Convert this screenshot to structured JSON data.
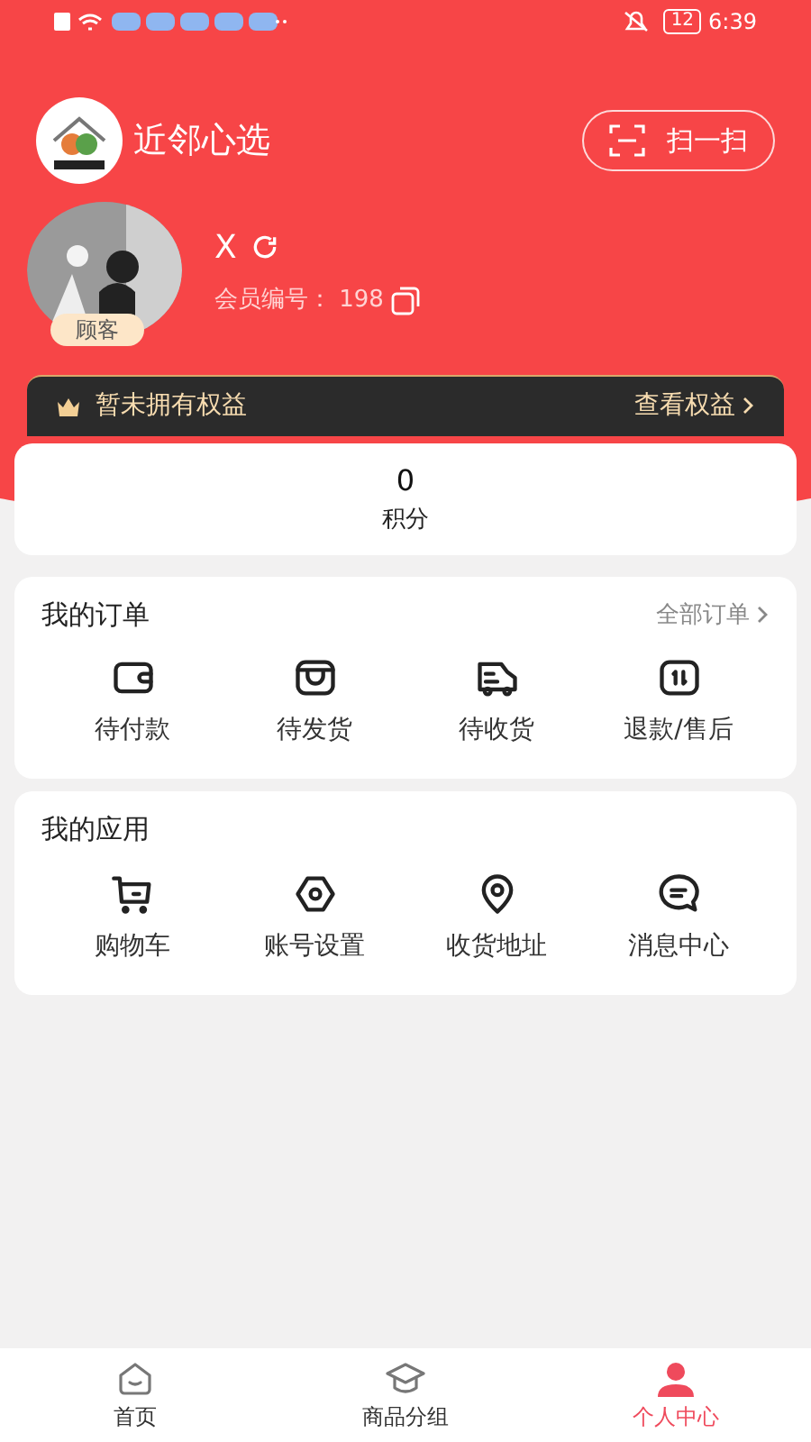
{
  "status_bar": {
    "battery": "12",
    "time": "6:39"
  },
  "header": {
    "app_name": "近邻心选",
    "scan_button": "扫一扫"
  },
  "profile": {
    "name": "X",
    "member_label": "会员编号：",
    "member_no": "198",
    "badge": "顾客"
  },
  "benefits": {
    "text": "暂未拥有权益",
    "link": "查看权益"
  },
  "points": {
    "value": "0",
    "label": "积分"
  },
  "orders": {
    "title": "我的订单",
    "link": "全部订单",
    "items": [
      {
        "kind": "wallet",
        "label": "待付款"
      },
      {
        "kind": "box",
        "label": "待发货"
      },
      {
        "kind": "truck",
        "label": "待收货"
      },
      {
        "kind": "refund",
        "label": "退款/售后"
      }
    ]
  },
  "apps": {
    "title": "我的应用",
    "items": [
      {
        "kind": "cart",
        "label": "购物车"
      },
      {
        "kind": "settings",
        "label": "账号设置"
      },
      {
        "kind": "pin",
        "label": "收货地址"
      },
      {
        "kind": "message",
        "label": "消息中心"
      }
    ]
  },
  "tabs": [
    {
      "kind": "home",
      "label": "首页",
      "selected": false
    },
    {
      "kind": "category",
      "label": "商品分组",
      "selected": false
    },
    {
      "kind": "user",
      "label": "个人中心",
      "selected": true
    }
  ]
}
